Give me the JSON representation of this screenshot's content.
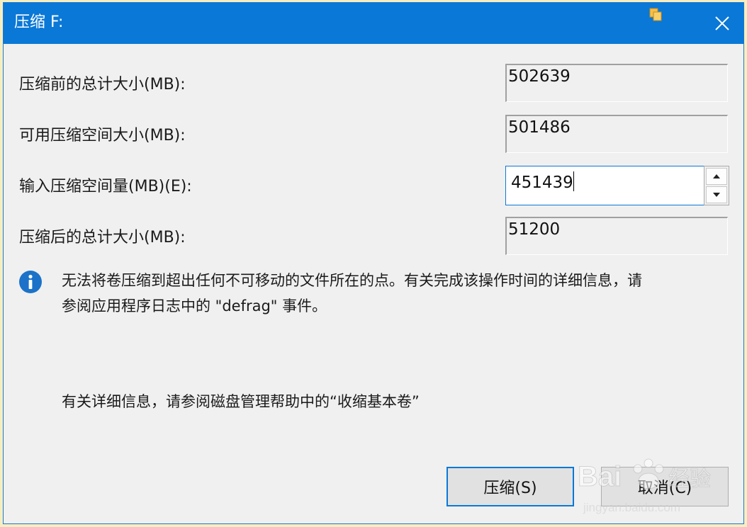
{
  "window": {
    "title": "压缩 F:",
    "close_icon": "close-icon",
    "app_icon": "disk-management-icon"
  },
  "fields": {
    "total_before": {
      "label": "压缩前的总计大小(MB):",
      "value": "502639"
    },
    "available": {
      "label": "可用压缩空间大小(MB):",
      "value": "501486"
    },
    "shrink_amount": {
      "label": "输入压缩空间量(MB)(E):",
      "value": "451439"
    },
    "total_after": {
      "label": "压缩后的总计大小(MB):",
      "value": "51200"
    }
  },
  "info": {
    "icon": "info-icon",
    "text_line1": "无法将卷压缩到超出任何不可移动的文件所在的点。有关完成该操作时间的详细信息，请",
    "text_line2": "参阅应用程序日志中的 \"defrag\" 事件。"
  },
  "help": {
    "text": "有关详细信息，请参阅磁盘管理帮助中的“收缩基本卷”"
  },
  "buttons": {
    "shrink": "压缩(S)",
    "cancel": "取消(C)"
  },
  "watermark": {
    "brand": "Bai",
    "brand2": "经验",
    "url": "jingyan.baidu.com"
  },
  "colors": {
    "titlebar": "#0a78d7",
    "window_bg": "#f0f0f0",
    "info_icon": "#1b72c8"
  }
}
